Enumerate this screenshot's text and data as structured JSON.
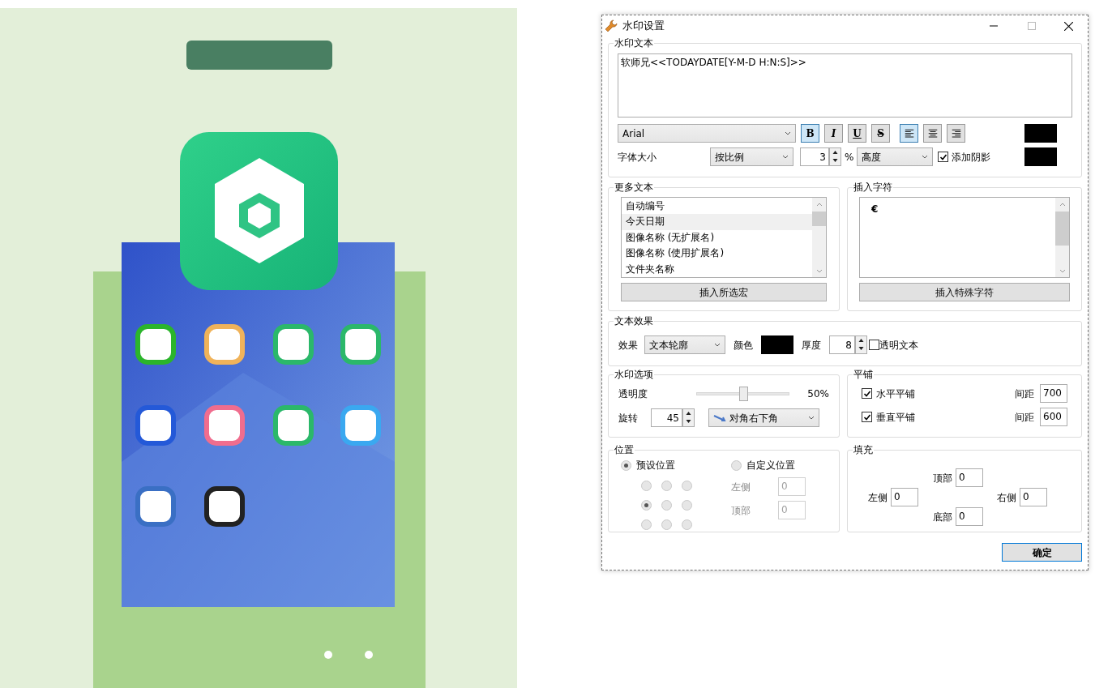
{
  "window": {
    "title": "水印设置"
  },
  "watermark_text": {
    "title": "水印文本",
    "value": "软师兄<<TODAYDATE[Y-M-D H:N:S]>>"
  },
  "font": {
    "value": "Arial"
  },
  "style_buttons": [
    {
      "label": "B",
      "selected": true
    },
    {
      "label": "I",
      "selected": false
    },
    {
      "label": "U",
      "selected": false
    },
    {
      "label": "S",
      "selected": false
    }
  ],
  "align_buttons": [
    {
      "kind": "left",
      "selected": true
    },
    {
      "kind": "center",
      "selected": false
    },
    {
      "kind": "right",
      "selected": false
    }
  ],
  "font_size": {
    "label": "字体大小",
    "mode": "按比例",
    "value": "3",
    "unit": "%",
    "basis": "高度",
    "shadow": {
      "label": "添加阴影",
      "checked": true
    }
  },
  "more_text": {
    "title": "更多文本",
    "items": [
      {
        "label": "自动编号",
        "selected": false
      },
      {
        "label": "今天日期",
        "selected": true
      },
      {
        "label": "图像名称 (无扩展名)",
        "selected": false
      },
      {
        "label": "图像名称 (使用扩展名)",
        "selected": false
      },
      {
        "label": "文件夹名称",
        "selected": false
      }
    ],
    "button": "插入所选宏"
  },
  "insert_char": {
    "title": "插入字符",
    "items": [
      "€"
    ],
    "button": "插入特殊字符"
  },
  "text_effect": {
    "title": "文本效果",
    "effect_label": "效果",
    "effect": "文本轮廓",
    "color_label": "颜色",
    "thickness_label": "厚度",
    "thickness": "8",
    "transparent": {
      "label": "透明文本",
      "checked": false
    }
  },
  "watermark_options": {
    "title": "水印选项",
    "opacity_label": "透明度",
    "level": 0.5,
    "reading": "50%",
    "rotate_label": "旋转",
    "rotate": "45",
    "direction": "对角右下角"
  },
  "tiling": {
    "title": "平铺",
    "rows": [
      {
        "label": "水平平铺",
        "checked": true,
        "spacing_label": "间距",
        "spacing": "700"
      },
      {
        "label": "垂直平铺",
        "checked": true,
        "spacing_label": "间距",
        "spacing": "600"
      }
    ]
  },
  "position": {
    "title": "位置",
    "options": [
      {
        "label": "预设位置",
        "selected": true
      },
      {
        "label": "自定义位置",
        "selected": false
      }
    ],
    "grid": [
      {
        "selected": false
      },
      {
        "selected": false
      },
      {
        "selected": false
      },
      {
        "selected": true
      },
      {
        "selected": false
      },
      {
        "selected": false
      },
      {
        "selected": false
      },
      {
        "selected": false
      },
      {
        "selected": false
      }
    ],
    "fields": [
      {
        "label": "左侧",
        "value": "0",
        "disabled": true
      },
      {
        "label": "顶部",
        "value": "0",
        "disabled": true
      }
    ]
  },
  "padding": {
    "title": "填充",
    "top": {
      "label": "顶部",
      "value": "0"
    },
    "left": {
      "label": "左侧",
      "value": "0"
    },
    "right": {
      "label": "右侧",
      "value": "0"
    },
    "bottom": {
      "label": "底部",
      "value": "0"
    }
  },
  "ok_button": "确定"
}
